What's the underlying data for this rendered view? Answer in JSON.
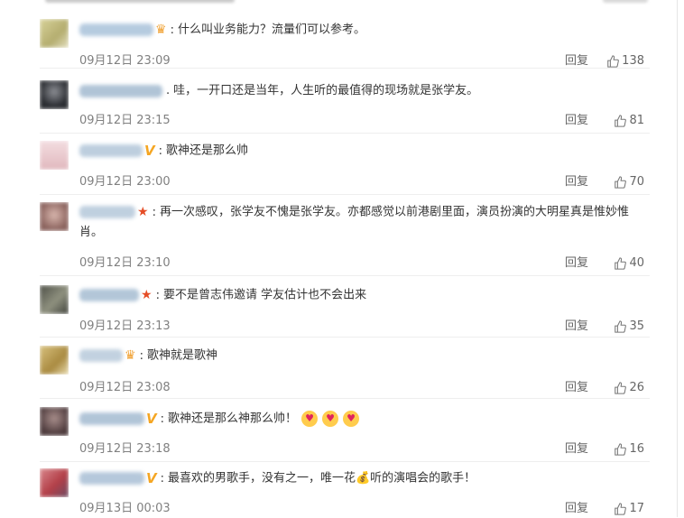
{
  "comments": [
    {
      "avatar_color": "#c9c28a",
      "badge": "crown",
      "text": "什么叫业务能力？流量们可以参考。",
      "time": "09月12日 23:09",
      "reply": "回复",
      "likes": "138"
    },
    {
      "avatar_color": "#2e3138",
      "badge": "",
      "text": "哇，一开口还是当年，人生听的最值得的现场就是张学友。",
      "time": "09月12日 23:15",
      "reply": "回复",
      "likes": "81"
    },
    {
      "avatar_color": "#e8c8cc",
      "badge": "v",
      "text": "歌神还是那么帅",
      "time": "09月12日 23:00",
      "reply": "回复",
      "likes": "70"
    },
    {
      "avatar_color": "#b08a84",
      "badge": "star",
      "text": "再一次感叹，张学友不愧是张学友。亦都感觉以前港剧里面，演员扮演的大明星真是惟妙惟肖。",
      "time": "09月12日 23:10",
      "reply": "回复",
      "likes": "40"
    },
    {
      "avatar_color": "#6c6e63",
      "badge": "star",
      "text": "要不是曾志伟邀请 学友估计也不会出来",
      "time": "09月12日 23:13",
      "reply": "回复",
      "likes": "35"
    },
    {
      "avatar_color": "#c4a35a",
      "badge": "crown",
      "text": "歌神就是歌神",
      "time": "09月12日 23:08",
      "reply": "回复",
      "likes": "26"
    },
    {
      "avatar_color": "#5d4a4c",
      "badge": "v",
      "text": "歌神还是那么神那么帅！",
      "time": "09月12日 23:18",
      "reply": "回复",
      "likes": "16"
    },
    {
      "avatar_color": "#c65a62",
      "badge": "v",
      "text": "最喜欢的男歌手，没有之一，唯一花💰听的演唱会的歌手！",
      "time": "09月13日 00:03",
      "reply": "回复",
      "likes": "17"
    }
  ]
}
